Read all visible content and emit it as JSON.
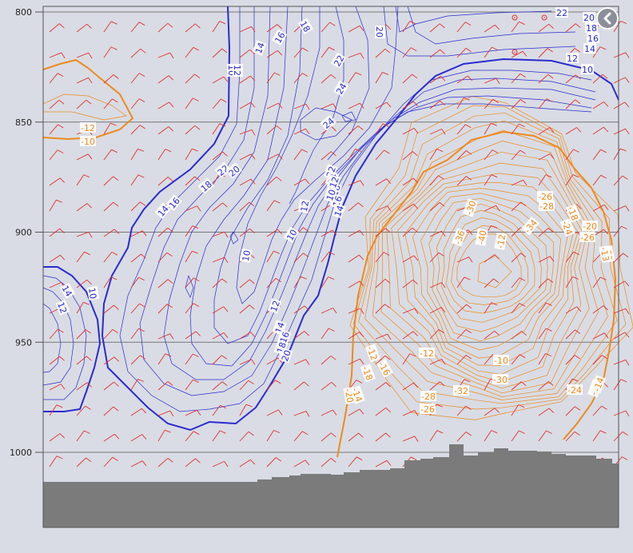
{
  "chart_data": {
    "type": "contour",
    "title": "",
    "xlabel": "",
    "ylabel": "",
    "y_axis": {
      "ticks": [
        "800",
        "850",
        "900",
        "950",
        "1000"
      ],
      "ylim": [
        1000,
        800
      ]
    },
    "grid": "horizontal lines at labeled pressure levels",
    "colors": {
      "cold_contours": "#2a2ad0",
      "warm_contours": "#ee8a1c",
      "wind_barbs": "#e03030",
      "terrain": "#7b7b7b",
      "grid": "#777777",
      "background": "#d9dce4"
    },
    "blue_contour_labels": [
      "22",
      "20",
      "18",
      "16",
      "14",
      "12",
      "10",
      "10",
      "12",
      "14",
      "16",
      "18",
      "20",
      "22",
      "24",
      "24",
      "22",
      "20",
      "18",
      "16",
      "14",
      "12",
      "10",
      "10",
      "12",
      "14",
      "16",
      "18",
      "20",
      "22",
      "24",
      "18",
      "16",
      "14",
      "12",
      "10",
      "12",
      "14",
      "10"
    ],
    "orange_contour_labels": [
      "-12",
      "-10",
      "-30",
      "-36",
      "-40",
      "-34",
      "-26",
      "-28",
      "-18",
      "-24",
      "-20",
      "-26",
      "-22",
      "-12",
      "-18",
      "-16",
      "-20",
      "-14",
      "-12",
      "-10",
      "-30",
      "-32",
      "-28",
      "-26",
      "-24",
      "-22",
      "-14",
      "-12",
      "-13"
    ],
    "markers": [
      "circled-dot",
      "circled-dot",
      "circled-dot"
    ]
  },
  "ui": {
    "back_icon": "chevron-left-icon"
  }
}
